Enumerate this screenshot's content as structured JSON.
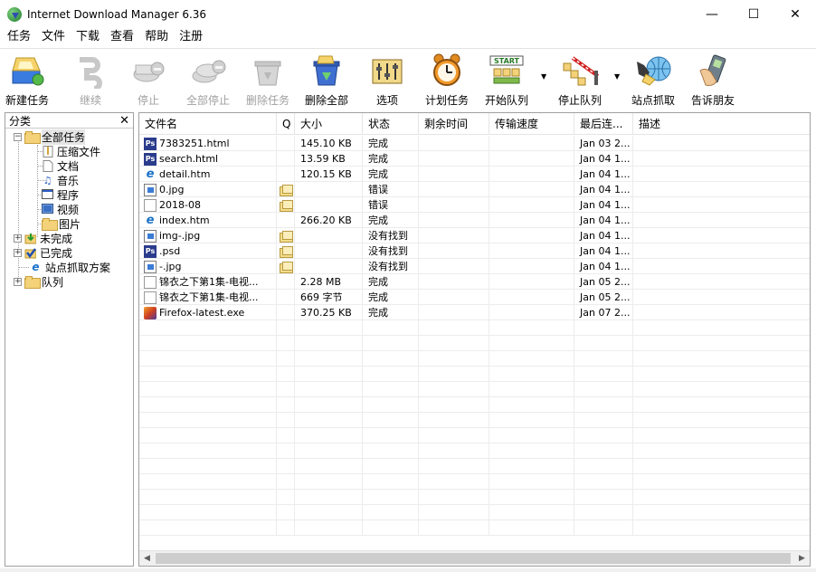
{
  "window": {
    "title": "Internet Download Manager 6.36",
    "minimize": "—",
    "maximize": "☐",
    "close": "✕"
  },
  "menu": [
    "任务",
    "文件",
    "下载",
    "查看",
    "帮助",
    "注册"
  ],
  "toolbar": [
    {
      "label": "新建任务",
      "icon": "add-task-icon",
      "enabled": true
    },
    {
      "label": "继续",
      "icon": "resume-icon",
      "enabled": false
    },
    {
      "label": "停止",
      "icon": "stop-icon",
      "enabled": false
    },
    {
      "label": "全部停止",
      "icon": "stop-all-icon",
      "enabled": false
    },
    {
      "label": "删除任务",
      "icon": "delete-task-icon",
      "enabled": false
    },
    {
      "label": "删除全部",
      "icon": "delete-all-icon",
      "enabled": true
    },
    {
      "label": "选项",
      "icon": "options-icon",
      "enabled": true
    },
    {
      "label": "计划任务",
      "icon": "scheduler-icon",
      "enabled": true
    },
    {
      "label": "开始队列",
      "icon": "start-queue-icon",
      "enabled": true
    },
    {
      "label": "停止队列",
      "icon": "stop-queue-icon",
      "enabled": true
    },
    {
      "label": "站点抓取",
      "icon": "site-grabber-icon",
      "enabled": true
    },
    {
      "label": "告诉朋友",
      "icon": "tell-friend-icon",
      "enabled": true
    }
  ],
  "toolbar_extra": {
    "start_queue_text": "START"
  },
  "categories": {
    "header": "分类",
    "close": "✕",
    "items": [
      {
        "label": "全部任务",
        "level": 0,
        "expander": "−",
        "selected": true
      },
      {
        "label": "压缩文件",
        "level": 1,
        "icon": "archive-icon"
      },
      {
        "label": "文档",
        "level": 1,
        "icon": "document-icon"
      },
      {
        "label": "音乐",
        "level": 1,
        "icon": "music-icon"
      },
      {
        "label": "程序",
        "level": 1,
        "icon": "program-icon"
      },
      {
        "label": "视频",
        "level": 1,
        "icon": "video-icon"
      },
      {
        "label": "图片",
        "level": 1,
        "icon": "picture-folder-icon"
      },
      {
        "label": "未完成",
        "level": 0,
        "expander": "+",
        "icon": "unfinished-icon"
      },
      {
        "label": "已完成",
        "level": 0,
        "expander": "+",
        "icon": "finished-icon"
      },
      {
        "label": "站点抓取方案",
        "level": 0,
        "icon": "grabber-project-icon"
      },
      {
        "label": "队列",
        "level": 0,
        "expander": "+",
        "icon": "queue-folder-icon"
      }
    ]
  },
  "columns": [
    "文件名",
    "Q",
    "大小",
    "状态",
    "剩余时间",
    "传输速度",
    "最后连...",
    "描述"
  ],
  "files": [
    {
      "name": "7383251.html",
      "type": "ps",
      "q": false,
      "size": "145.10 KB",
      "status": "完成",
      "last": "Jan 03 2..."
    },
    {
      "name": "search.html",
      "type": "ps",
      "q": false,
      "size": "13.59 KB",
      "status": "完成",
      "last": "Jan 04 1..."
    },
    {
      "name": "detail.htm",
      "type": "ie",
      "q": false,
      "size": "120.15 KB",
      "status": "完成",
      "last": "Jan 04 1..."
    },
    {
      "name": "0.jpg",
      "type": "img",
      "q": true,
      "size": "",
      "status": "错误",
      "last": "Jan 04 1..."
    },
    {
      "name": "2018-08",
      "type": "doc",
      "q": true,
      "size": "",
      "status": "错误",
      "last": "Jan 04 1..."
    },
    {
      "name": "index.htm",
      "type": "ie",
      "q": false,
      "size": "266.20 KB",
      "status": "完成",
      "last": "Jan 04 1..."
    },
    {
      "name": "img-.jpg",
      "type": "img",
      "q": true,
      "size": "",
      "status": "没有找到",
      "last": "Jan 04 1..."
    },
    {
      "name": ".psd",
      "type": "ps",
      "q": true,
      "size": "",
      "status": "没有找到",
      "last": "Jan 04 1..."
    },
    {
      "name": "-.jpg",
      "type": "img",
      "q": true,
      "size": "",
      "status": "没有找到",
      "last": "Jan 04 1..."
    },
    {
      "name": "锦衣之下第1集-电视...",
      "type": "doc",
      "q": false,
      "size": "2.28 MB",
      "status": "完成",
      "last": "Jan 05 2..."
    },
    {
      "name": "锦衣之下第1集-电视...",
      "type": "doc",
      "q": false,
      "size": "669 字节",
      "status": "完成",
      "last": "Jan 05 2..."
    },
    {
      "name": "Firefox-latest.exe",
      "type": "exe",
      "q": false,
      "size": "370.25 KB",
      "status": "完成",
      "last": "Jan 07 2..."
    }
  ],
  "scroll": {
    "left": "◀",
    "right": "▶"
  }
}
